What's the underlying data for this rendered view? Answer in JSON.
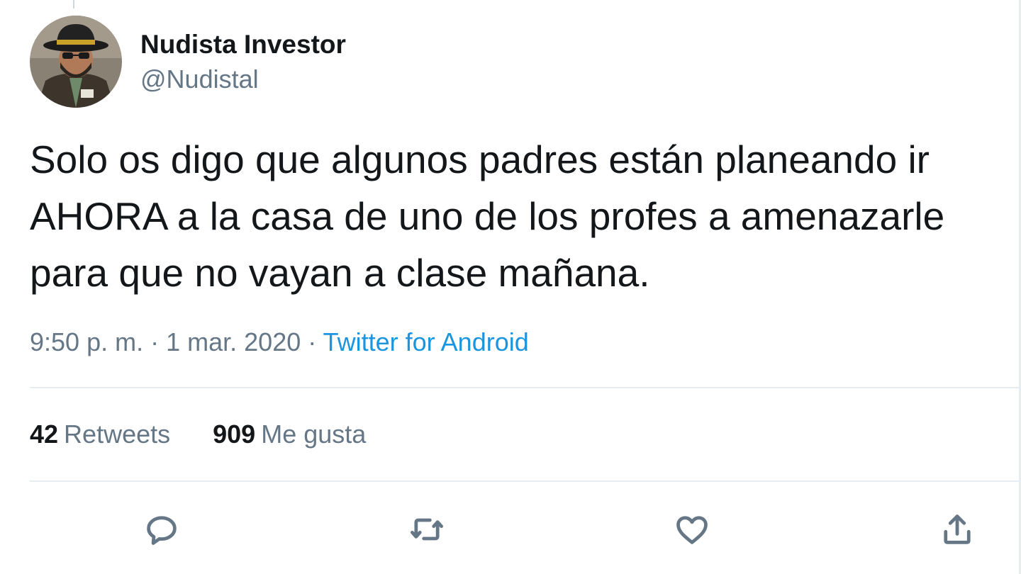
{
  "author": {
    "name": "Nudista Investor",
    "handle": "@Nudistal"
  },
  "tweet": {
    "text": "Solo os digo que algunos padres están planeando ir\nAHORA a la casa de uno de los profes a amenazarle\npara que no vayan a clase mañana.",
    "time": "9:50 p. m.",
    "date": "1 mar. 2020",
    "separator": "·",
    "source": "Twitter for Android"
  },
  "stats": {
    "retweets_count": "42",
    "retweets_label": "Retweets",
    "likes_count": "909",
    "likes_label": "Me gusta"
  },
  "actions": {
    "reply_icon": "reply-icon",
    "retweet_icon": "retweet-icon",
    "like_icon": "heart-icon",
    "share_icon": "share-icon"
  },
  "colors": {
    "text": "#14171a",
    "secondary": "#657786",
    "link": "#1b95e0",
    "divider": "#e6ecf0"
  }
}
